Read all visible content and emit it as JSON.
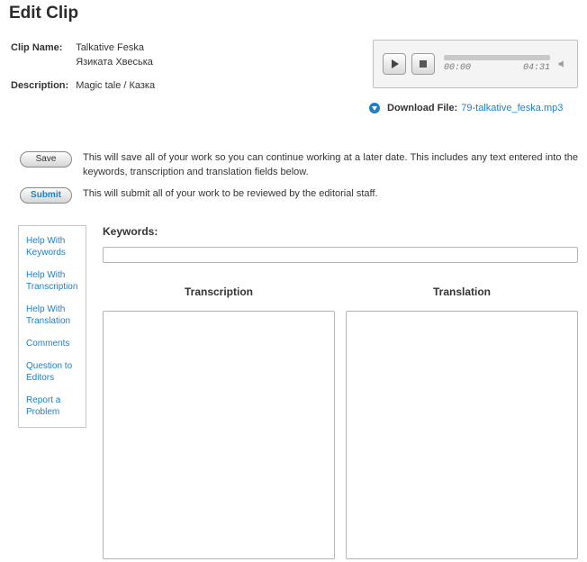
{
  "title": "Edit Clip",
  "meta": {
    "name_label": "Clip Name:",
    "name_line1": "Talkative Feska",
    "name_line2": "Язиката Хвеська",
    "desc_label": "Description:",
    "desc_value": "Magic tale / Казка"
  },
  "player": {
    "current": "00:00",
    "duration": "04:31"
  },
  "download": {
    "label": "Download File:",
    "filename": "79-talkative_feska.mp3"
  },
  "actions": {
    "save_label": "Save",
    "save_desc": "This will save all of your work so you can continue working at a later date. This includes any text entered into the keywords, transcription and translation fields below.",
    "submit_label": "Submit",
    "submit_desc": "This will submit all of your work to be reviewed by the editorial staff."
  },
  "help": {
    "keywords": "Help With Keywords",
    "transcription": "Help With Transcription",
    "translation": "Help With Translation",
    "comments": "Comments",
    "question": "Question to Editors",
    "report": "Report a Problem"
  },
  "fields": {
    "keywords_label": "Keywords:",
    "keywords_value": "",
    "transcription_label": "Transcription",
    "transcription_value": "",
    "translation_label": "Translation",
    "translation_value": ""
  }
}
